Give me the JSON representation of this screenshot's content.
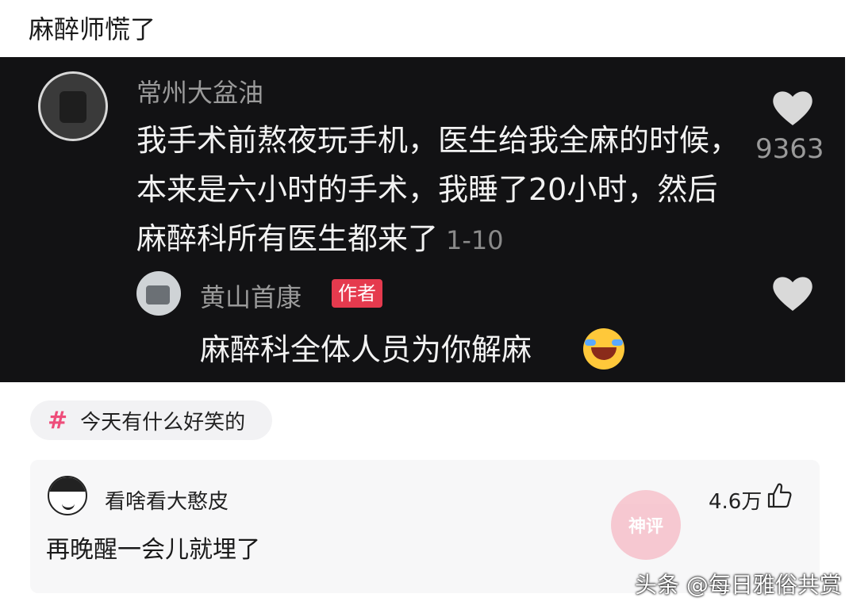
{
  "post": {
    "title": "麻醉师慌了"
  },
  "comment": {
    "author": "常州大盆油",
    "text": "我手术前熬夜玩手机，医生给我全麻的时候，本来是六小时的手术，我睡了20小时，然后麻醉科所有医生都来了",
    "date": "1-10",
    "likes": "9363",
    "like_icon": "heart-icon"
  },
  "reply": {
    "author": "黄山首康",
    "badge": "作者",
    "text": "麻醉科全体人员为你解麻",
    "emoji": "laughing-tears-emoji",
    "like_icon": "heart-icon"
  },
  "topic": {
    "hash": "#",
    "label": "今天有什么好笑的"
  },
  "bottom_comment": {
    "author": "看啥看大憨皮",
    "likes": "4.6万",
    "text": "再晚醒一会儿就埋了",
    "stamp": "神评",
    "like_icon": "thumbs-up-icon"
  },
  "watermark": "头条 @每日雅俗共赏",
  "colors": {
    "dark_bg": "#121214",
    "badge_red": "#e53a4e",
    "topic_hash": "#ee4d7a"
  }
}
